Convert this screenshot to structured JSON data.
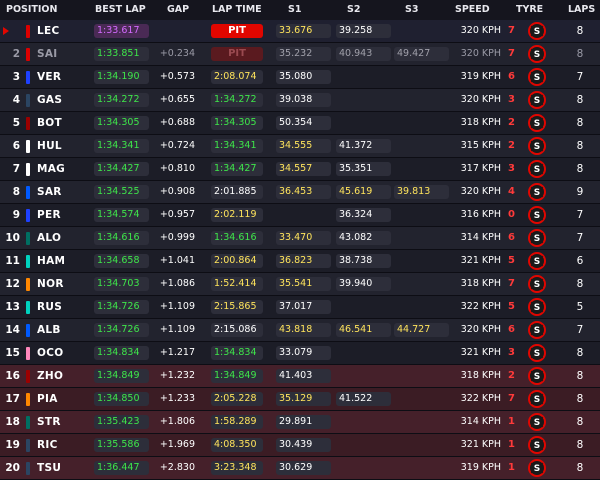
{
  "headers": {
    "position": "POSITION",
    "best_lap": "BEST LAP",
    "gap": "GAP",
    "lap_time": "LAP TIME",
    "s1": "S1",
    "s2": "S2",
    "s3": "S3",
    "speed": "SPEED",
    "tyre": "TYRE",
    "laps": "LAPS"
  },
  "tyre_symbol": "S",
  "colors": {
    "background": "#15151e",
    "accent_red": "#e10600",
    "green_time": "#3ee64a",
    "yellow_time": "#ffe45c",
    "purple_time": "#d46bff",
    "soft_tyre": "#e10600"
  },
  "rows": [
    {
      "pos": "",
      "driver": "LEC",
      "team_color": "#dc0000",
      "best": "1:33.617",
      "best_purple": true,
      "gap": "",
      "lap": "PIT",
      "lap_style": "pit",
      "s1": "33.676",
      "s1_style": "yellow",
      "s2": "39.258",
      "s2_style": "white",
      "s3": "",
      "s3_style": "",
      "speed": "320 KPH",
      "tyre_age": "7",
      "laps": "8",
      "elim": false,
      "dim": false,
      "arrow": true
    },
    {
      "pos": "2",
      "driver": "SAI",
      "team_color": "#dc0000",
      "best": "1:33.851",
      "best_purple": false,
      "gap": "+0.234",
      "lap": "PIT",
      "lap_style": "pitdim",
      "s1": "35.232",
      "s1_style": "yellow",
      "s2": "40.943",
      "s2_style": "white",
      "s3": "49.427",
      "s3_style": "white",
      "speed": "320 KPH",
      "tyre_age": "7",
      "laps": "8",
      "elim": false,
      "dim": true,
      "arrow": false
    },
    {
      "pos": "3",
      "driver": "VER",
      "team_color": "#1e41ff",
      "best": "1:34.190",
      "best_purple": false,
      "gap": "+0.573",
      "lap": "2:08.074",
      "lap_style": "yellow",
      "s1": "35.080",
      "s1_style": "white",
      "s2": "",
      "s2_style": "",
      "s3": "",
      "s3_style": "",
      "speed": "319 KPH",
      "tyre_age": "6",
      "laps": "7",
      "elim": false,
      "dim": false,
      "arrow": false
    },
    {
      "pos": "4",
      "driver": "GAS",
      "team_color": "#2b4562",
      "best": "1:34.272",
      "best_purple": false,
      "gap": "+0.655",
      "lap": "1:34.272",
      "lap_style": "green",
      "s1": "39.038",
      "s1_style": "white",
      "s2": "",
      "s2_style": "",
      "s3": "",
      "s3_style": "",
      "speed": "320 KPH",
      "tyre_age": "3",
      "laps": "8",
      "elim": false,
      "dim": false,
      "arrow": false
    },
    {
      "pos": "5",
      "driver": "BOT",
      "team_color": "#9b0000",
      "best": "1:34.305",
      "best_purple": false,
      "gap": "+0.688",
      "lap": "1:34.305",
      "lap_style": "green",
      "s1": "50.354",
      "s1_style": "white",
      "s2": "",
      "s2_style": "",
      "s3": "",
      "s3_style": "",
      "speed": "318 KPH",
      "tyre_age": "2",
      "laps": "8",
      "elim": false,
      "dim": false,
      "arrow": false
    },
    {
      "pos": "6",
      "driver": "HUL",
      "team_color": "#ffffff",
      "best": "1:34.341",
      "best_purple": false,
      "gap": "+0.724",
      "lap": "1:34.341",
      "lap_style": "green",
      "s1": "34.555",
      "s1_style": "yellow",
      "s2": "41.372",
      "s2_style": "white",
      "s3": "",
      "s3_style": "",
      "speed": "315 KPH",
      "tyre_age": "2",
      "laps": "8",
      "elim": false,
      "dim": false,
      "arrow": false
    },
    {
      "pos": "7",
      "driver": "MAG",
      "team_color": "#ffffff",
      "best": "1:34.427",
      "best_purple": false,
      "gap": "+0.810",
      "lap": "1:34.427",
      "lap_style": "green",
      "s1": "34.557",
      "s1_style": "yellow",
      "s2": "35.351",
      "s2_style": "white",
      "s3": "",
      "s3_style": "",
      "speed": "317 KPH",
      "tyre_age": "3",
      "laps": "8",
      "elim": false,
      "dim": false,
      "arrow": false
    },
    {
      "pos": "8",
      "driver": "SAR",
      "team_color": "#005aff",
      "best": "1:34.525",
      "best_purple": false,
      "gap": "+0.908",
      "lap": "2:01.885",
      "lap_style": "white",
      "s1": "36.453",
      "s1_style": "yellow",
      "s2": "45.619",
      "s2_style": "yellow",
      "s3": "39.813",
      "s3_style": "yellow",
      "speed": "320 KPH",
      "tyre_age": "4",
      "laps": "9",
      "elim": false,
      "dim": false,
      "arrow": false
    },
    {
      "pos": "9",
      "driver": "PER",
      "team_color": "#1e41ff",
      "best": "1:34.574",
      "best_purple": false,
      "gap": "+0.957",
      "lap": "2:02.119",
      "lap_style": "yellow",
      "s1": "",
      "s1_style": "",
      "s2": "36.324",
      "s2_style": "white",
      "s3": "",
      "s3_style": "",
      "speed": "316 KPH",
      "tyre_age": "0",
      "laps": "7",
      "elim": false,
      "dim": false,
      "arrow": false
    },
    {
      "pos": "10",
      "driver": "ALO",
      "team_color": "#006f62",
      "best": "1:34.616",
      "best_purple": false,
      "gap": "+0.999",
      "lap": "1:34.616",
      "lap_style": "green",
      "s1": "33.470",
      "s1_style": "yellow",
      "s2": "43.082",
      "s2_style": "white",
      "s3": "",
      "s3_style": "",
      "speed": "314 KPH",
      "tyre_age": "6",
      "laps": "7",
      "elim": false,
      "dim": false,
      "arrow": false
    },
    {
      "pos": "11",
      "driver": "HAM",
      "team_color": "#00d2be",
      "best": "1:34.658",
      "best_purple": false,
      "gap": "+1.041",
      "lap": "2:00.864",
      "lap_style": "yellow",
      "s1": "36.823",
      "s1_style": "yellow",
      "s2": "38.738",
      "s2_style": "white",
      "s3": "",
      "s3_style": "",
      "speed": "321 KPH",
      "tyre_age": "5",
      "laps": "6",
      "elim": false,
      "dim": false,
      "arrow": false
    },
    {
      "pos": "12",
      "driver": "NOR",
      "team_color": "#ff8700",
      "best": "1:34.703",
      "best_purple": false,
      "gap": "+1.086",
      "lap": "1:52.414",
      "lap_style": "yellow",
      "s1": "35.541",
      "s1_style": "yellow",
      "s2": "39.940",
      "s2_style": "white",
      "s3": "",
      "s3_style": "",
      "speed": "318 KPH",
      "tyre_age": "7",
      "laps": "8",
      "elim": false,
      "dim": false,
      "arrow": false
    },
    {
      "pos": "13",
      "driver": "RUS",
      "team_color": "#00d2be",
      "best": "1:34.726",
      "best_purple": false,
      "gap": "+1.109",
      "lap": "2:15.865",
      "lap_style": "yellow",
      "s1": "37.017",
      "s1_style": "white",
      "s2": "",
      "s2_style": "",
      "s3": "",
      "s3_style": "",
      "speed": "322 KPH",
      "tyre_age": "5",
      "laps": "5",
      "elim": false,
      "dim": false,
      "arrow": false
    },
    {
      "pos": "14",
      "driver": "ALB",
      "team_color": "#005aff",
      "best": "1:34.726",
      "best_purple": false,
      "gap": "+1.109",
      "lap": "2:15.086",
      "lap_style": "white",
      "s1": "43.818",
      "s1_style": "yellow",
      "s2": "46.541",
      "s2_style": "yellow",
      "s3": "44.727",
      "s3_style": "yellow",
      "speed": "320 KPH",
      "tyre_age": "6",
      "laps": "7",
      "elim": false,
      "dim": false,
      "arrow": false
    },
    {
      "pos": "15",
      "driver": "OCO",
      "team_color": "#ff87bc",
      "best": "1:34.834",
      "best_purple": false,
      "gap": "+1.217",
      "lap": "1:34.834",
      "lap_style": "green",
      "s1": "33.079",
      "s1_style": "white",
      "s2": "",
      "s2_style": "",
      "s3": "",
      "s3_style": "",
      "speed": "321 KPH",
      "tyre_age": "3",
      "laps": "8",
      "elim": false,
      "dim": false,
      "arrow": false
    },
    {
      "pos": "16",
      "driver": "ZHO",
      "team_color": "#9b0000",
      "best": "1:34.849",
      "best_purple": false,
      "gap": "+1.232",
      "lap": "1:34.849",
      "lap_style": "green",
      "s1": "41.403",
      "s1_style": "white",
      "s2": "",
      "s2_style": "",
      "s3": "",
      "s3_style": "",
      "speed": "318 KPH",
      "tyre_age": "2",
      "laps": "8",
      "elim": true,
      "dim": false,
      "arrow": false
    },
    {
      "pos": "17",
      "driver": "PIA",
      "team_color": "#ff8700",
      "best": "1:34.850",
      "best_purple": false,
      "gap": "+1.233",
      "lap": "2:05.228",
      "lap_style": "yellow",
      "s1": "35.129",
      "s1_style": "yellow",
      "s2": "41.522",
      "s2_style": "white",
      "s3": "",
      "s3_style": "",
      "speed": "322 KPH",
      "tyre_age": "7",
      "laps": "8",
      "elim": true,
      "dim": false,
      "arrow": false
    },
    {
      "pos": "18",
      "driver": "STR",
      "team_color": "#006f62",
      "best": "1:35.423",
      "best_purple": false,
      "gap": "+1.806",
      "lap": "1:58.289",
      "lap_style": "yellow",
      "s1": "29.891",
      "s1_style": "white",
      "s2": "",
      "s2_style": "",
      "s3": "",
      "s3_style": "",
      "speed": "314 KPH",
      "tyre_age": "1",
      "laps": "8",
      "elim": true,
      "dim": false,
      "arrow": false
    },
    {
      "pos": "19",
      "driver": "RIC",
      "team_color": "#2b4562",
      "best": "1:35.586",
      "best_purple": false,
      "gap": "+1.969",
      "lap": "4:08.350",
      "lap_style": "yellow",
      "s1": "30.439",
      "s1_style": "white",
      "s2": "",
      "s2_style": "",
      "s3": "",
      "s3_style": "",
      "speed": "321 KPH",
      "tyre_age": "1",
      "laps": "8",
      "elim": true,
      "dim": false,
      "arrow": false
    },
    {
      "pos": "20",
      "driver": "TSU",
      "team_color": "#2b4562",
      "best": "1:36.447",
      "best_purple": false,
      "gap": "+2.830",
      "lap": "3:23.348",
      "lap_style": "yellow",
      "s1": "30.629",
      "s1_style": "white",
      "s2": "",
      "s2_style": "",
      "s3": "",
      "s3_style": "",
      "speed": "319 KPH",
      "tyre_age": "1",
      "laps": "8",
      "elim": true,
      "dim": false,
      "arrow": false
    }
  ]
}
